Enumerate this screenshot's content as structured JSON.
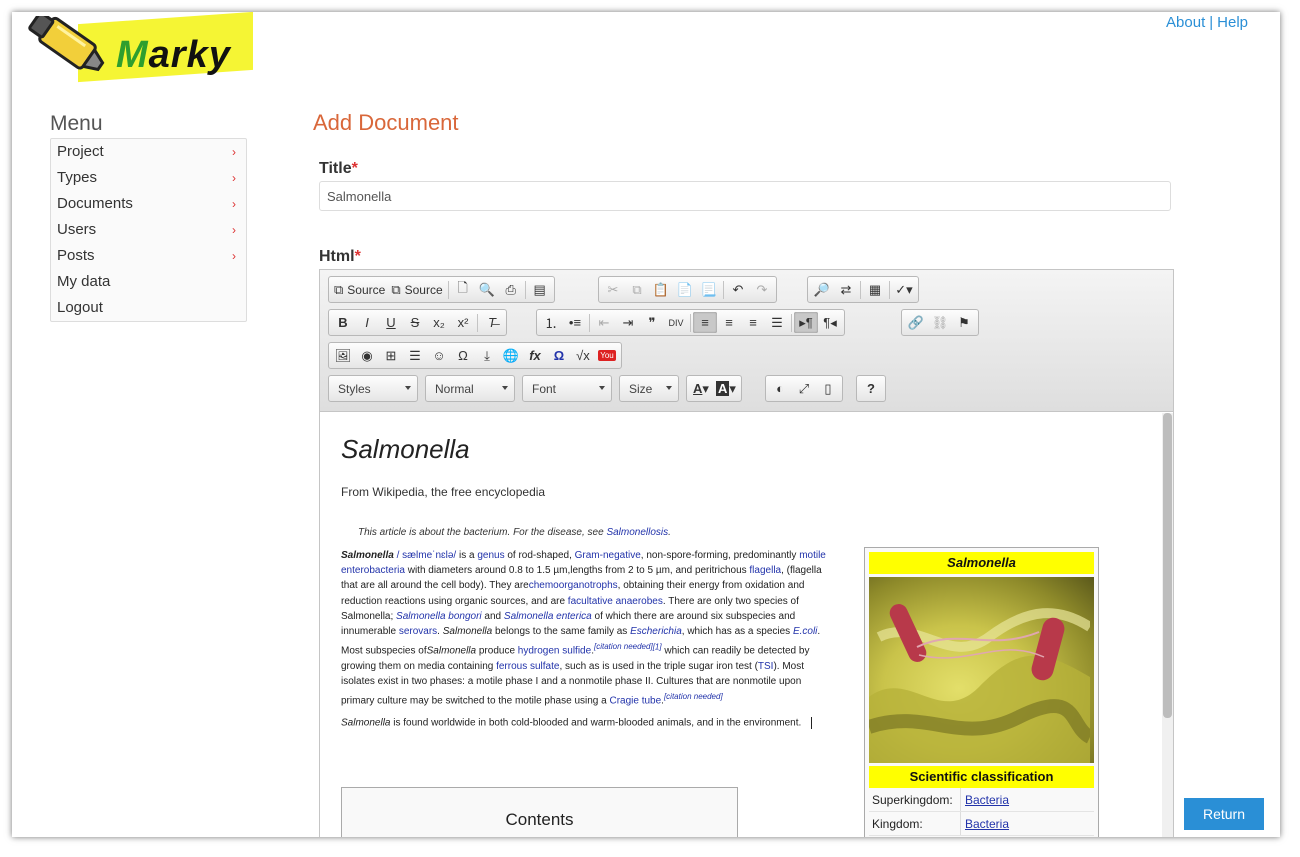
{
  "app": {
    "brand_first": "M",
    "brand_rest": "arky"
  },
  "toplinks": {
    "about": "About",
    "sep": "|",
    "help": "Help"
  },
  "menu": {
    "title": "Menu",
    "items": [
      {
        "label": "Project",
        "chevron": "›"
      },
      {
        "label": "Types",
        "chevron": "›"
      },
      {
        "label": "Documents",
        "chevron": "›"
      },
      {
        "label": "Users",
        "chevron": "›"
      },
      {
        "label": "Posts",
        "chevron": "›"
      },
      {
        "label": "My data",
        "chevron": ""
      },
      {
        "label": "Logout",
        "chevron": ""
      }
    ]
  },
  "form": {
    "page_title": "Add Document",
    "title_label": "Title",
    "html_label": "Html",
    "required_mark": "*",
    "title_value": "Salmonella"
  },
  "toolbar": {
    "source1": "Source",
    "source2": "Source",
    "styles": "Styles",
    "format": "Normal",
    "font": "Font",
    "size": "Size",
    "help": "?"
  },
  "document": {
    "heading": "Salmonella",
    "subtitle": "From Wikipedia, the free encyclopedia",
    "hatnote_prefix": "This article is about the bacterium. For the disease, see ",
    "hatnote_link": "Salmonellosis",
    "hatnote_suffix": ".",
    "body": {
      "s1_bold": "Salmonella",
      "s1_pron": " / sælmeˈnɛlə/",
      "s1_a": " is a ",
      "s1_genus": "genus",
      "s1_b": " of rod-shaped, ",
      "s1_gram": "Gram-negative",
      "s1_c": ", non-spore-forming, predominantly ",
      "s1_motile": "motile",
      "s1_d": " ",
      "s1_entero": "enterobacteria",
      "s1_e": " with diameters around 0.8 to 1.5 µm,lengths from 2 to 5 µm, and peritrichous ",
      "s1_flagella": "flagella",
      "s1_f": ", (flagella that are all around the cell body). They are",
      "s1_chemo": "chemoorganotrophs",
      "s1_g": ", obtaining their energy from oxidation and reduction reactions using organic sources, and are ",
      "s1_facult": "facultative anaerobes",
      "s1_h": ". There are only two species of Salmonella; ",
      "s1_bongori": "Salmonella bongori",
      "s1_i": " and ",
      "s1_enterica": "Salmonella enterica",
      "s1_j": " of which there are around six subspecies and innumerable ",
      "s1_serovars": "serovars",
      "s1_k": ". ",
      "s1_salm2": "Salmonella",
      "s1_l": " belongs to the same family as ",
      "s1_esch": "Escherichia",
      "s1_m": ", which has as a species ",
      "s1_ecoli": "E.coli",
      "s1_n": ". Most subspecies of",
      "s1_salm3": "Salmonella",
      "s1_o": " produce ",
      "s1_h2s": "hydrogen sulfide",
      "s1_p": ".",
      "s1_cit1": "[citation needed]",
      "s1_ref": "[1]",
      "s1_q": " which can readily be detected by growing them on media containing ",
      "s1_ferrous": "ferrous sulfate",
      "s1_r": ", such as is used in the triple sugar iron test (",
      "s1_tsi": "TSI",
      "s1_s": "). Most isolates exist in two phases: a motile phase I and a nonmotile phase II. Cultures that are nonmotile upon primary culture may be switched to the motile phase using a ",
      "s1_cragie": "Cragie tube",
      "s1_t": ".",
      "s1_cit2": "[citation needed]",
      "p2_italic": "Salmonella",
      "p2_rest": " is found worldwide in both cold-blooded and warm-blooded animals, and in the environment."
    },
    "contents_title": "Contents",
    "infobox": {
      "title": "Salmonella",
      "classification": "Scientific classification",
      "rows": [
        {
          "k": "Superkingdom:",
          "v": "Bacteria"
        },
        {
          "k": "Kingdom:",
          "v": "Bacteria"
        }
      ]
    }
  },
  "return_button": "Return",
  "colors": {
    "accent": "#2a8fd6",
    "title": "#d9673a",
    "highlight": "#ffff00",
    "brand_green": "#2e9e2e"
  }
}
